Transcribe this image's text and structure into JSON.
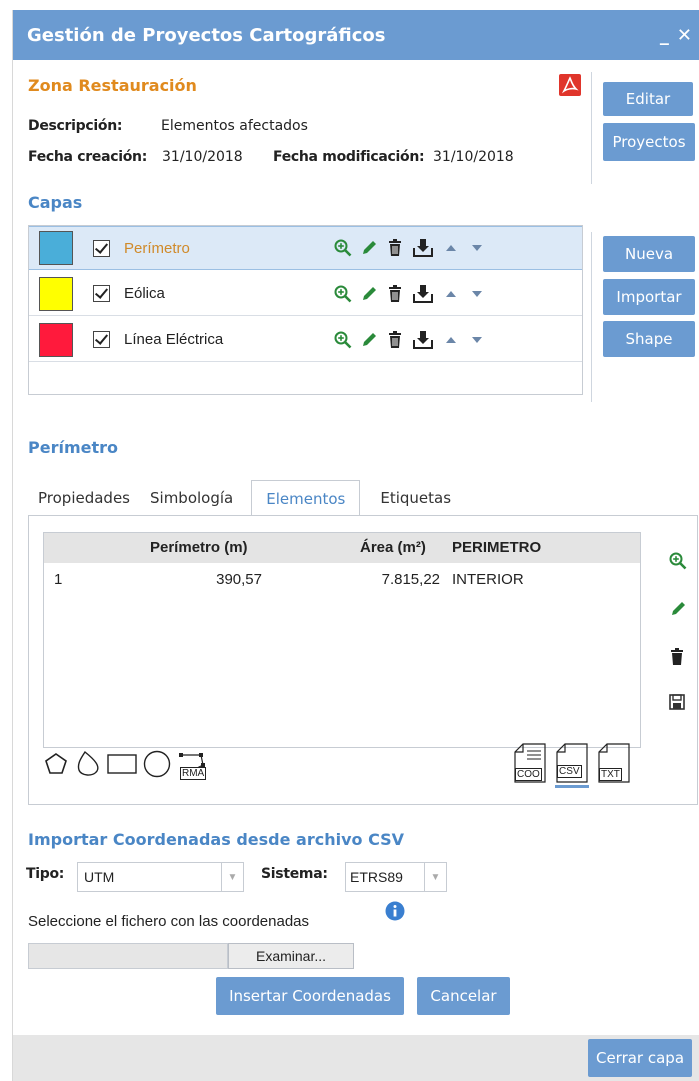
{
  "window": {
    "title": "Gestión de Proyectos Cartográficos",
    "minimize_label": "_",
    "close_label": "✕"
  },
  "project": {
    "name": "Zona Restauración",
    "description_label": "Descripción:",
    "description_value": "Elementos afectados",
    "created_label": "Fecha creación:",
    "created_value": "31/10/2018",
    "modified_label": "Fecha modificación:",
    "modified_value": "31/10/2018"
  },
  "side_buttons": {
    "edit": "Editar",
    "projects": "Proyectos",
    "new": "Nueva",
    "import": "Importar",
    "shape": "Shape"
  },
  "layers": {
    "title": "Capas",
    "items": [
      {
        "name": "Perímetro",
        "color": "#4aaed9",
        "checked": true,
        "selected": true
      },
      {
        "name": "Eólica",
        "color": "#ffff00",
        "checked": true,
        "selected": false
      },
      {
        "name": "Línea Eléctrica",
        "color": "#ff1a3c",
        "checked": true,
        "selected": false
      }
    ]
  },
  "layer_detail": {
    "title": "Perímetro",
    "tabs": [
      "Propiedades",
      "Simbología",
      "Elementos",
      "Etiquetas"
    ],
    "active_tab": "Elementos",
    "table": {
      "headers": {
        "perimeter": "Perímetro (m)",
        "area": "Área (m²)",
        "type": "PERIMETRO"
      },
      "rows": [
        {
          "id": "1",
          "perimeter": "390,57",
          "area": "7.815,22",
          "type": "INTERIOR"
        }
      ]
    },
    "draw_tools": [
      "polygon-icon",
      "freehand-icon",
      "rectangle-icon",
      "circle-icon",
      "rma-icon"
    ],
    "rma_label": "RMA",
    "formats": [
      "COO",
      "CSV",
      "TXT"
    ],
    "active_format": "CSV"
  },
  "import_csv": {
    "title": "Importar Coordenadas desde archivo CSV",
    "type_label": "Tipo:",
    "type_value": "UTM",
    "system_label": "Sistema:",
    "system_value": "ETRS89",
    "file_hint": "Seleccione el fichero con las coordenadas",
    "browse_label": "Examinar...",
    "insert_label": "Insertar Coordenadas",
    "cancel_label": "Cancelar"
  },
  "footer": {
    "close_layer_label": "Cerrar capa"
  },
  "colors": {
    "accent": "#6b9bd1",
    "section": "#4a86c5",
    "project_name": "#e08a1e",
    "pdf": "#e0352b"
  }
}
